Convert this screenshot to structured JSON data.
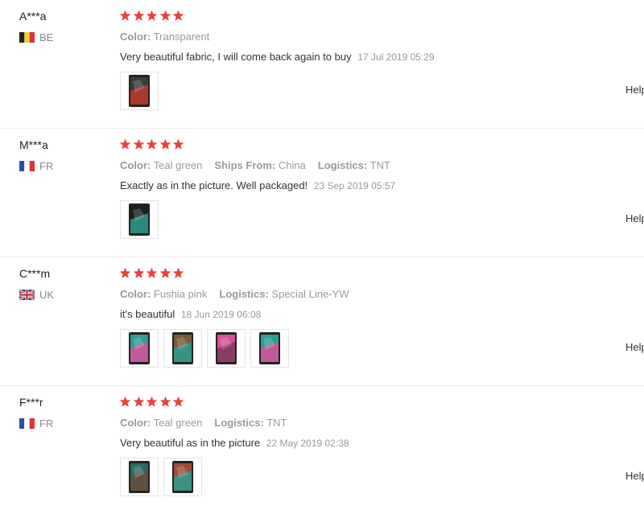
{
  "reviews": [
    {
      "user": "A***a",
      "country": "BE",
      "country_flag": "be",
      "rating": 5,
      "attributes": [
        {
          "key": "Color:",
          "value": "Transparent"
        }
      ],
      "text": "Very beautiful fabric, I will come back again to buy",
      "date": "17 Jul 2019 05:29",
      "photos": [
        {
          "icon": "photo-thumbnail",
          "colors": [
            "#3a3a3a",
            "#c0392b"
          ]
        }
      ],
      "helpful_label": "Help"
    },
    {
      "user": "M***a",
      "country": "FR",
      "country_flag": "fr",
      "rating": 5,
      "attributes": [
        {
          "key": "Color:",
          "value": "Teal green"
        },
        {
          "key": "Ships From:",
          "value": "China"
        },
        {
          "key": "Logistics:",
          "value": "TNT"
        }
      ],
      "text": "Exactly as in the picture. Well packaged!",
      "date": "23 Sep 2019 05:57",
      "photos": [
        {
          "icon": "photo-thumbnail",
          "colors": [
            "#1f1f1f",
            "#2a9d8f"
          ]
        }
      ],
      "helpful_label": "Help"
    },
    {
      "user": "C***m",
      "country": "UK",
      "country_flag": "uk",
      "rating": 5,
      "attributes": [
        {
          "key": "Color:",
          "value": "Fushia pink"
        },
        {
          "key": "Logistics:",
          "value": "Special Line-YW"
        }
      ],
      "text": "it's beautiful",
      "date": "18 Jun 2019 06:08",
      "photos": [
        {
          "icon": "photo-thumbnail",
          "colors": [
            "#2a9d8f",
            "#d94f9c"
          ]
        },
        {
          "icon": "photo-thumbnail",
          "colors": [
            "#7a5a3a",
            "#2a9d8f"
          ]
        },
        {
          "icon": "photo-thumbnail",
          "colors": [
            "#d94f9c",
            "#7a3a5a"
          ]
        },
        {
          "icon": "photo-thumbnail",
          "colors": [
            "#2a9d8f",
            "#d94f9c"
          ]
        }
      ],
      "helpful_label": "Help"
    },
    {
      "user": "F***r",
      "country": "FR",
      "country_flag": "fr",
      "rating": 5,
      "attributes": [
        {
          "key": "Color:",
          "value": "Teal green"
        },
        {
          "key": "Logistics:",
          "value": "TNT"
        }
      ],
      "text": "Very beautiful as in the picture",
      "date": "22 May 2019 02:38",
      "photos": [
        {
          "icon": "photo-thumbnail",
          "colors": [
            "#2a6b5f",
            "#6b4a3a"
          ]
        },
        {
          "icon": "photo-thumbnail",
          "colors": [
            "#a04a3a",
            "#2a9d8f"
          ]
        }
      ],
      "helpful_label": "Help"
    }
  ],
  "colors": {
    "star": "#e8413c",
    "muted_text": "#999999",
    "divider": "#ececec"
  }
}
